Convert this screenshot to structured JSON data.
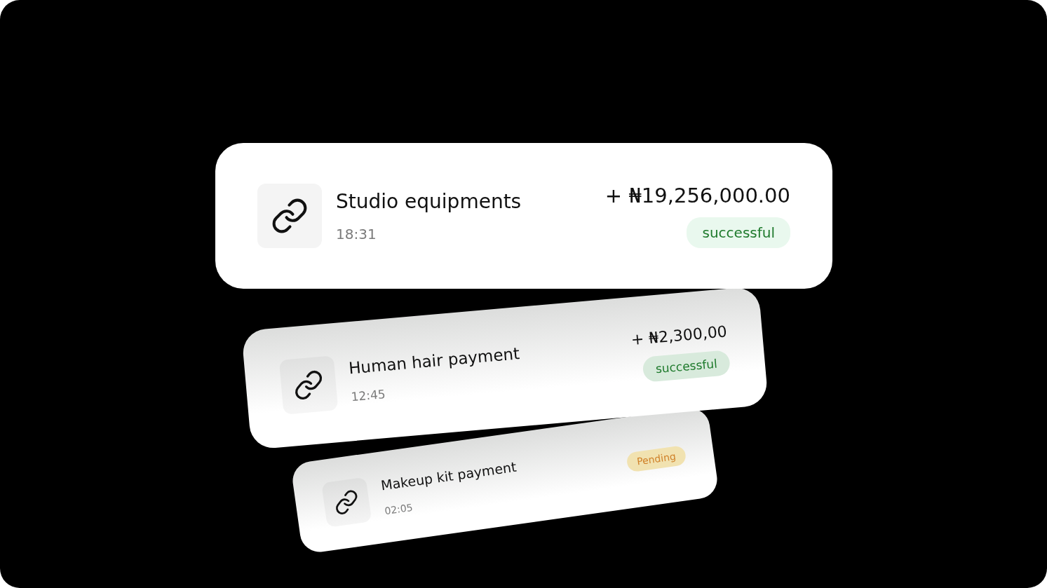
{
  "transactions": [
    {
      "name": "Studio equipments",
      "time": "18:31",
      "amount": "+ ₦19,256,000.00",
      "status": {
        "label": "successful",
        "kind": "success"
      }
    },
    {
      "name": "Human hair payment",
      "time": "12:45",
      "amount": "+ ₦2,300,00",
      "status": {
        "label": "successful",
        "kind": "success"
      }
    },
    {
      "name": "Makeup kit payment",
      "time": "02:05",
      "status": {
        "label": "Pending",
        "kind": "pending"
      }
    }
  ]
}
